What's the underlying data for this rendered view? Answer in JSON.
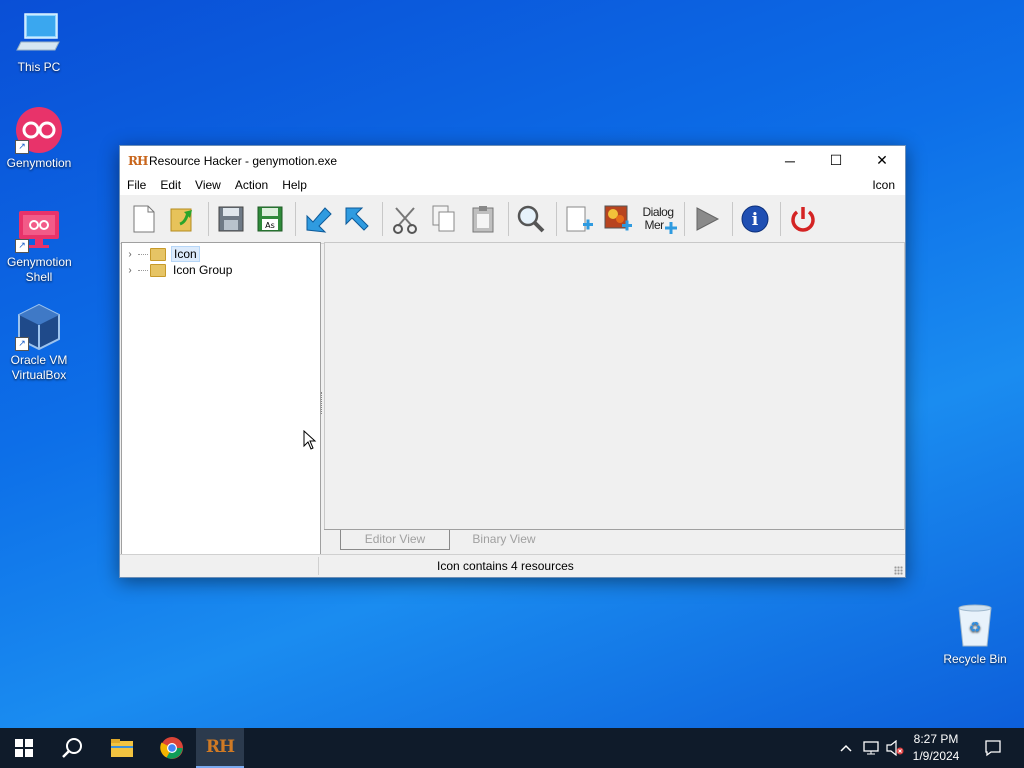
{
  "desktop": {
    "icons": [
      {
        "label": "This PC"
      },
      {
        "label": "Genymotion"
      },
      {
        "label": "Genymotion Shell"
      },
      {
        "label": "Oracle VM VirtualBox"
      },
      {
        "label": "Recycle Bin"
      }
    ]
  },
  "window": {
    "title": "Resource Hacker - genymotion.exe",
    "logo_text": "RH",
    "buttons": {
      "minimize": "─",
      "maximize": "☐",
      "close": "✕"
    },
    "menu": [
      "File",
      "Edit",
      "View",
      "Action",
      "Help"
    ],
    "menu_right": "Icon",
    "toolbar": {
      "dialog_label_1": "Dialog",
      "dialog_label_2": "Mer"
    },
    "tree": [
      {
        "label": "Icon",
        "selected": true
      },
      {
        "label": "Icon Group",
        "selected": false
      }
    ],
    "tabs": [
      "Editor View",
      "Binary View"
    ],
    "status": "Icon contains 4 resources"
  },
  "taskbar": {
    "time": "8:27 PM",
    "date": "1/9/2024",
    "apps": [
      "start-icon",
      "search-icon",
      "file-explorer-icon",
      "chrome-icon",
      "resource-hacker-icon"
    ]
  },
  "colors": {
    "desktop_blue": "#0d6fe8",
    "accent_red": "#e8336a",
    "taskbar": "#0f1b2a"
  }
}
